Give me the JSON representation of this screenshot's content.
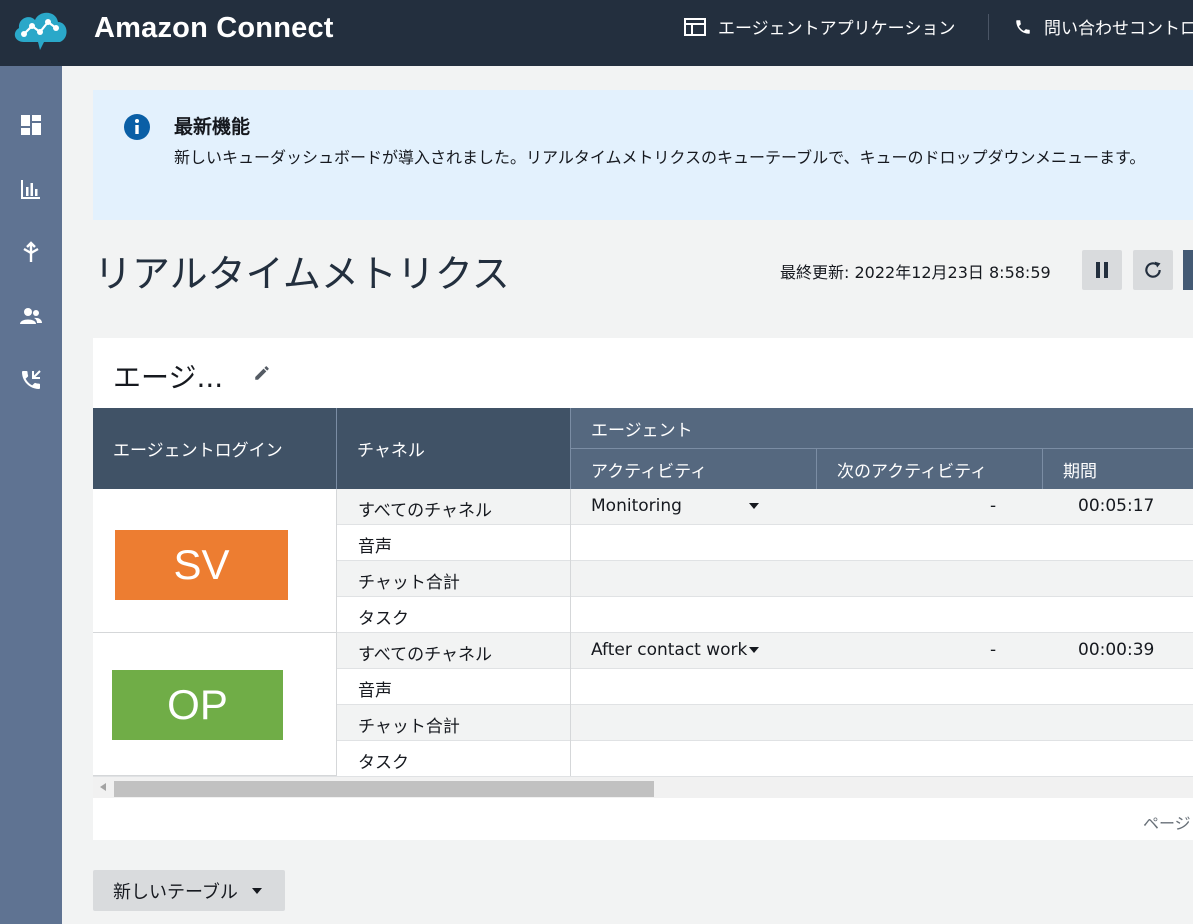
{
  "header": {
    "app_title": "Amazon Connect",
    "agent_app_label": "エージェントアプリケーション",
    "ccp_label": "問い合わせコントロ"
  },
  "sidebar": {
    "items": [
      {
        "icon": "dashboard-icon"
      },
      {
        "icon": "metrics-icon"
      },
      {
        "icon": "routing-icon"
      },
      {
        "icon": "users-icon"
      },
      {
        "icon": "channels-icon"
      }
    ]
  },
  "banner": {
    "title": "最新機能",
    "text": "新しいキューダッシュボードが導入されました。リアルタイムメトリクスのキューテーブルで、キューのドロップダウンメニューます。"
  },
  "page": {
    "title": "リアルタイムメトリクス",
    "last_updated": "最終更新: 2022年12月23日 8:58:59"
  },
  "table": {
    "title": "エージ...",
    "headers": {
      "agent_login": "エージェントログイン",
      "channel": "チャネル",
      "agent_group": "エージェント",
      "activity": "アクティビティ",
      "next_activity": "次のアクティビティ",
      "duration": "期間"
    },
    "agents": [
      {
        "login": "SV",
        "badge_color": "#ed7d31",
        "rows": [
          {
            "channel": "すべてのチャネル",
            "activity": "Monitoring",
            "next_activity": "-",
            "duration": "00:05:17"
          },
          {
            "channel": "音声",
            "activity": "",
            "next_activity": "",
            "duration": ""
          },
          {
            "channel": "チャット合計",
            "activity": "",
            "next_activity": "",
            "duration": ""
          },
          {
            "channel": "タスク",
            "activity": "",
            "next_activity": "",
            "duration": ""
          }
        ]
      },
      {
        "login": "OP",
        "badge_color": "#70ad47",
        "rows": [
          {
            "channel": "すべてのチャネル",
            "activity": "After contact work",
            "next_activity": "-",
            "duration": "00:00:39"
          },
          {
            "channel": "音声",
            "activity": "",
            "next_activity": "",
            "duration": ""
          },
          {
            "channel": "チャット合計",
            "activity": "",
            "next_activity": "",
            "duration": ""
          },
          {
            "channel": "タスク",
            "activity": "",
            "next_activity": "",
            "duration": ""
          }
        ]
      }
    ],
    "pager_label": "ページ"
  },
  "new_table_label": "新しいテーブル",
  "colors": {
    "topbar": "#232f3e",
    "sidebar": "#5f7392",
    "brand_teal": "#2aa8c9"
  }
}
